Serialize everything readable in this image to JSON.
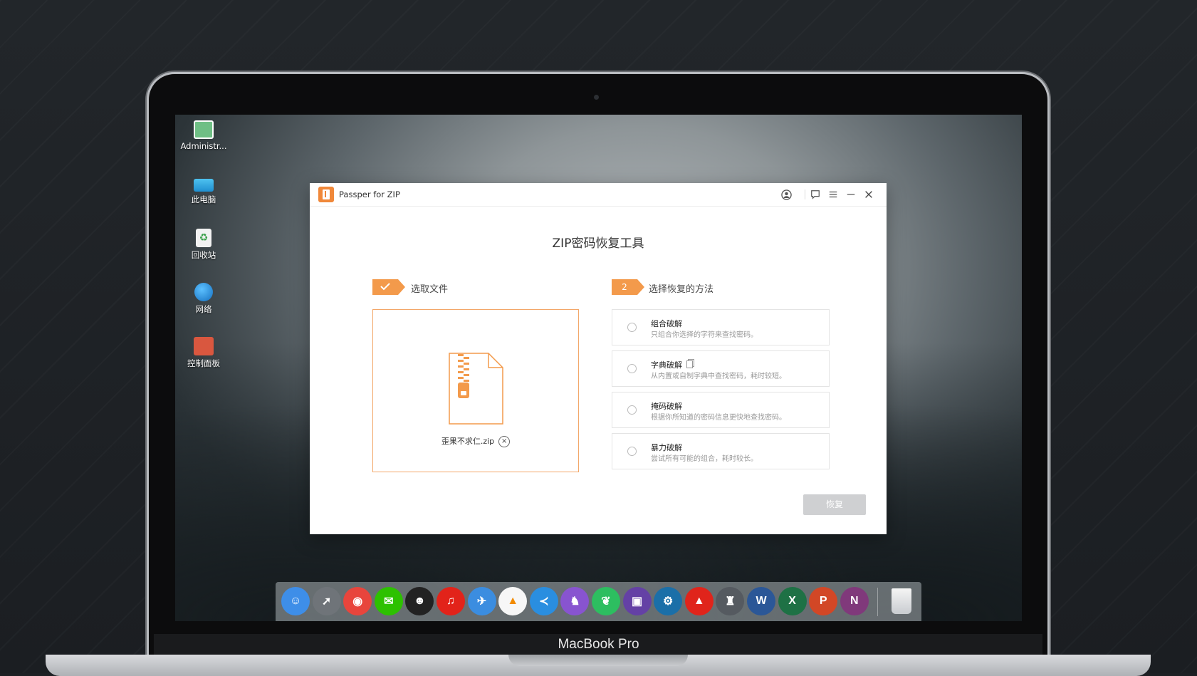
{
  "desktop": {
    "icons": [
      {
        "label": "Administr...",
        "icon": "user-folder-icon"
      },
      {
        "label": "此电脑",
        "icon": "computer-icon"
      },
      {
        "label": "回收站",
        "icon": "recycle-bin-icon"
      },
      {
        "label": "网络",
        "icon": "network-icon"
      },
      {
        "label": "控制面板",
        "icon": "control-panel-icon"
      }
    ]
  },
  "window": {
    "title": "Passper for ZIP",
    "main_title": "ZIP密码恢复工具",
    "step1": {
      "label": "选取文件",
      "state": "done"
    },
    "step2": {
      "number": "2",
      "label": "选择恢复的方法"
    },
    "file": {
      "name": "歪果不求仁.zip",
      "remove_symbol": "×"
    },
    "options": [
      {
        "title": "组合破解",
        "desc": "只组合你选择的字符来查找密码。"
      },
      {
        "title": "字典破解",
        "desc": "从内置或自制字典中查找密码，耗时较短。"
      },
      {
        "title": "掩码破解",
        "desc": "根据你所知道的密码信息更快地查找密码。"
      },
      {
        "title": "暴力破解",
        "desc": "尝试所有可能的组合，耗时较长。"
      }
    ],
    "restore_label": "恢复"
  },
  "dock": {
    "apps": [
      {
        "name": "finder",
        "color": "#3e8ee8",
        "glyph": "☺"
      },
      {
        "name": "launchpad",
        "color": "#6f7479",
        "glyph": "➚"
      },
      {
        "name": "chrome",
        "color": "#e8453c",
        "glyph": "◉"
      },
      {
        "name": "wechat",
        "color": "#2dc100",
        "glyph": "✉"
      },
      {
        "name": "qq",
        "color": "#222222",
        "glyph": "☻"
      },
      {
        "name": "netease-music",
        "color": "#e2231a",
        "glyph": "♫"
      },
      {
        "name": "mail-bird",
        "color": "#3b8de0",
        "glyph": "✈"
      },
      {
        "name": "vlc",
        "color": "#f7f7f7",
        "glyph": "▲"
      },
      {
        "name": "vscode",
        "color": "#2a8ee0",
        "glyph": "≺"
      },
      {
        "name": "github",
        "color": "#8854d0",
        "glyph": "♞"
      },
      {
        "name": "evernote",
        "color": "#2dbe60",
        "glyph": "❦"
      },
      {
        "name": "twitch",
        "color": "#6441a5",
        "glyph": "▣"
      },
      {
        "name": "steam",
        "color": "#1b6fa8",
        "glyph": "⚙"
      },
      {
        "name": "acrobat",
        "color": "#e0241b",
        "glyph": "▲"
      },
      {
        "name": "rhino",
        "color": "#555a60",
        "glyph": "♜"
      },
      {
        "name": "word",
        "color": "#2b5797",
        "glyph": "W"
      },
      {
        "name": "excel",
        "color": "#1e7145",
        "glyph": "X"
      },
      {
        "name": "powerpoint",
        "color": "#d24726",
        "glyph": "P"
      },
      {
        "name": "onenote",
        "color": "#80397b",
        "glyph": "N"
      }
    ],
    "trash_icon": "trash-icon"
  },
  "device_label": "MacBook Pro",
  "colors": {
    "accent": "#f39a4b",
    "button_disabled": "#cfd0d2"
  }
}
